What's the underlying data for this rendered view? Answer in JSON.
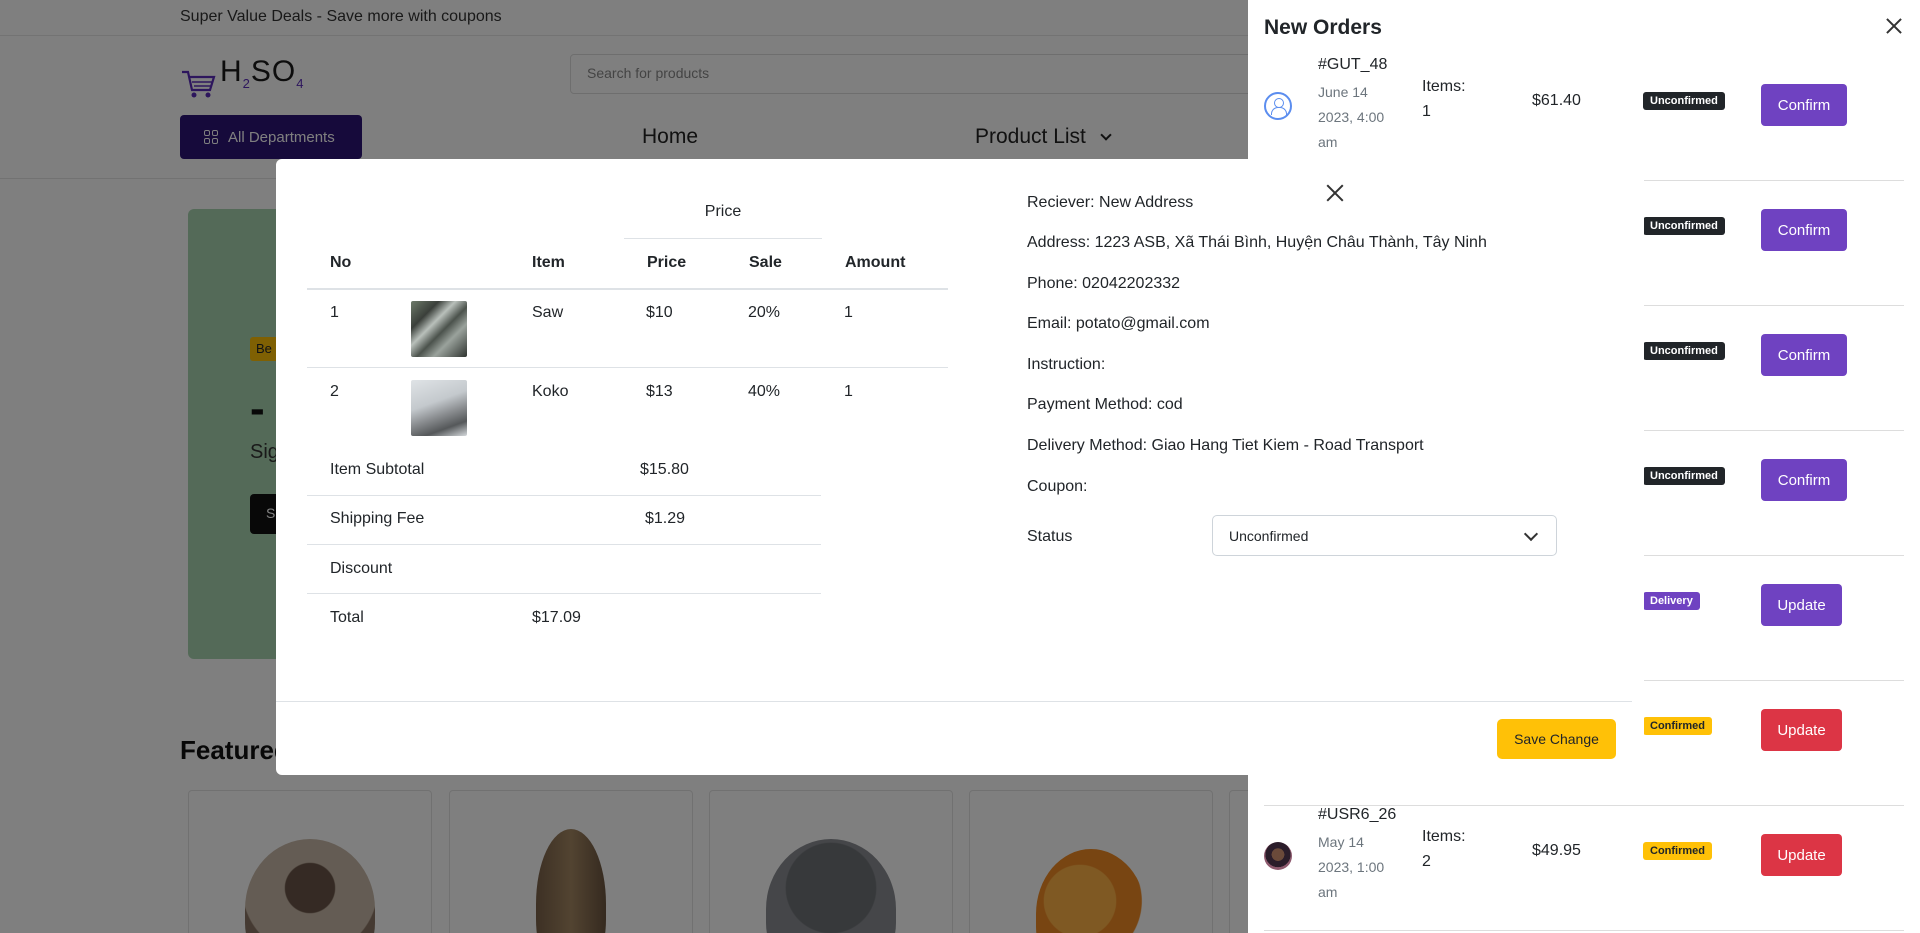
{
  "topbar": {
    "promo": "Super Value Deals - Save more with coupons"
  },
  "header": {
    "logo_text": "H2SO4",
    "search_placeholder": "Search for products",
    "all_departments": "All Departments",
    "nav_home": "Home",
    "nav_product_list": "Product List"
  },
  "hero": {
    "badge": "Be",
    "headline": "-",
    "subtitle": "Sig",
    "button": "S"
  },
  "featured": {
    "heading": "Featured"
  },
  "drawer": {
    "title": "New Orders",
    "orders": [
      {
        "id": "#GUT_48",
        "date": "June 14 2023, 4:00 am",
        "items_label": "Items:",
        "items_count": "1",
        "total": "$61.40",
        "status": "Unconfirmed",
        "action": "Confirm"
      },
      {
        "id": "",
        "date": "",
        "items_label": "",
        "items_count": "",
        "total": "",
        "status": "Unconfirmed",
        "action": "Confirm"
      },
      {
        "id": "",
        "date": "",
        "items_label": "",
        "items_count": "",
        "total": "",
        "status": "Unconfirmed",
        "action": "Confirm"
      },
      {
        "id": "",
        "date": "",
        "items_label": "",
        "items_count": "",
        "total": "",
        "status": "Unconfirmed",
        "action": "Confirm"
      },
      {
        "id": "",
        "date": "",
        "items_label": "",
        "items_count": "",
        "total": "",
        "status": "Delivery",
        "action": "Update"
      },
      {
        "id": "",
        "date": "",
        "items_label": "",
        "items_count": "",
        "total": "",
        "status": "Confirmed",
        "action": "Update"
      },
      {
        "id": "#USR6_26",
        "date": "May 14 2023, 1:00 am",
        "items_label": "Items:",
        "items_count": "2",
        "total": "$49.95",
        "status": "Confirmed",
        "action": "Update"
      }
    ]
  },
  "modal": {
    "price_group_header": "Price",
    "columns": {
      "no": "No",
      "item": "Item",
      "price": "Price",
      "sale": "Sale",
      "amount": "Amount"
    },
    "rows": [
      {
        "no": "1",
        "item": "Saw",
        "price": "$10",
        "sale": "20%",
        "amount": "1"
      },
      {
        "no": "2",
        "item": "Koko",
        "price": "$13",
        "sale": "40%",
        "amount": "1"
      }
    ],
    "summary": {
      "subtotal_label": "Item Subtotal",
      "subtotal_value": "$15.80",
      "shipping_label": "Shipping Fee",
      "shipping_value": "$1.29",
      "discount_label": "Discount",
      "discount_value": "",
      "total_label": "Total",
      "total_value": "$17.09"
    },
    "info": {
      "receiver": "Reciever: New Address",
      "address": "Address: 1223 ASB, Xã Thái Bình, Huyện Châu Thành, Tây Ninh",
      "phone": "Phone: 02042202332",
      "email": "Email: potato@gmail.com",
      "instruction": "Instruction:",
      "payment": "Payment Method: cod",
      "delivery": "Delivery Method: Giao Hang Tiet Kiem - Road Transport",
      "coupon": "Coupon:"
    },
    "status_label": "Status",
    "status_value": "Unconfirmed",
    "save_button": "Save Change"
  },
  "colors": {
    "brand_purple": "#6f42c1",
    "dark_purple": "#2d1577",
    "warning": "#ffc107",
    "danger": "#dc3545",
    "dark_badge": "#212529"
  }
}
